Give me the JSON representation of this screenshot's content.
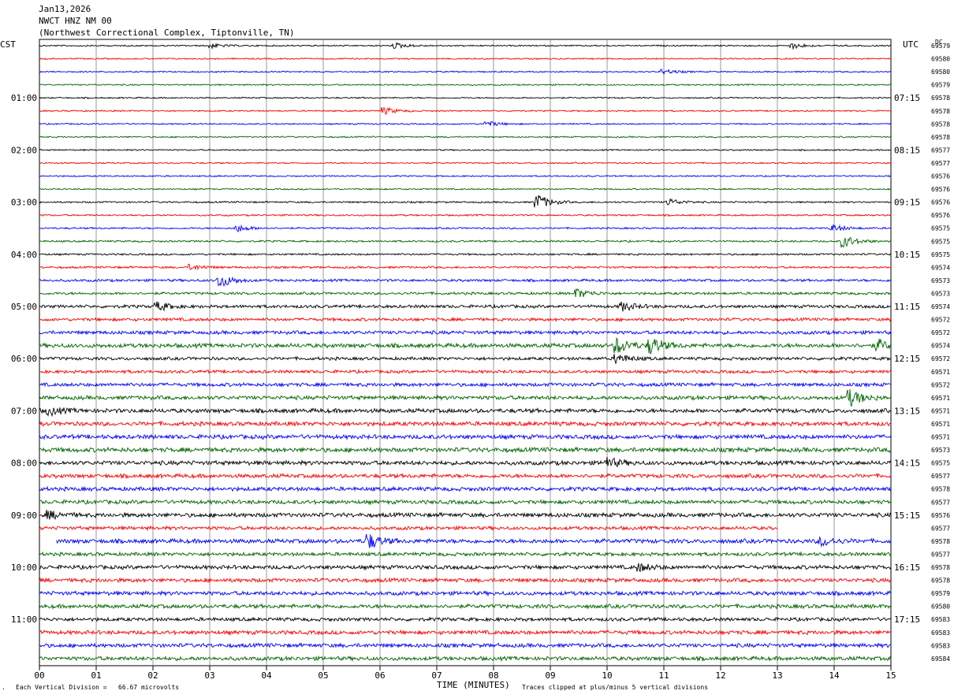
{
  "header": {
    "date": "Jan13,2026",
    "station": "NWCT HNZ NM 00",
    "site": "(Northwest Correctional Complex, Tiptonville, TN)"
  },
  "left_zone_label": "CST",
  "right_zone_label": "UTC",
  "dc_label": "DC",
  "footer": {
    "scale": "Each Vertical Division =   66.67 microvolts",
    "xlabel": "TIME (MINUTES)",
    "clip_note": "Traces clipped at plus/minus 5 vertical divisions"
  },
  "chart_data": {
    "type": "line",
    "title": "NWCT HNZ NM 00",
    "xlabel": "TIME (MINUTES)",
    "ylabel": "",
    "xlim": [
      0,
      15
    ],
    "x_ticks": [
      "00",
      "01",
      "02",
      "03",
      "04",
      "05",
      "06",
      "07",
      "08",
      "09",
      "10",
      "11",
      "12",
      "13",
      "14",
      "15"
    ],
    "grid": true,
    "trace_count": 48,
    "trace_colors": [
      "#000000",
      "#ff0000",
      "#0000ff",
      "#006400"
    ],
    "left_time_labels": [
      "01:00",
      "02:00",
      "03:00",
      "04:00",
      "05:00",
      "06:00",
      "07:00",
      "08:00",
      "09:00",
      "10:00",
      "11:00"
    ],
    "right_time_labels": [
      "07:15",
      "08:15",
      "09:15",
      "10:15",
      "11:15",
      "12:15",
      "13:15",
      "14:15",
      "15:15",
      "16:15",
      "17:15"
    ],
    "dc_offsets": [
      "69579",
      "69580",
      "69580",
      "69579",
      "69578",
      "69578",
      "69578",
      "69578",
      "69577",
      "69577",
      "69576",
      "69576",
      "69576",
      "69576",
      "69575",
      "69575",
      "69575",
      "69574",
      "69573",
      "69573",
      "69574",
      "69572",
      "69572",
      "69574",
      "69572",
      "69571",
      "69572",
      "69571",
      "69571",
      "69571",
      "69571",
      "69573",
      "69575",
      "69577",
      "69578",
      "69577",
      "69576",
      "69577",
      "69578",
      "69577",
      "69578",
      "69578",
      "69579",
      "69580",
      "69583",
      "69583",
      "69583",
      "69584"
    ],
    "activity": [
      1,
      1,
      1,
      1,
      1,
      1,
      1,
      1,
      1,
      1,
      1,
      1,
      1.2,
      1.2,
      1.2,
      1.3,
      1.3,
      1.5,
      1.8,
      1.8,
      2.2,
      2.2,
      2.5,
      3,
      2.2,
      2.2,
      2.5,
      2.8,
      3,
      3,
      3,
      3.2,
      3,
      2.8,
      2.8,
      2.8,
      3,
      2.5,
      3,
      2.5,
      2.8,
      2.8,
      2.8,
      2.8,
      2.5,
      2.8,
      2.8,
      2.8
    ],
    "events": [
      {
        "trace": 0,
        "minute": 3.0,
        "amp": 3
      },
      {
        "trace": 0,
        "minute": 6.3,
        "amp": 3
      },
      {
        "trace": 0,
        "minute": 13.3,
        "amp": 3
      },
      {
        "trace": 2,
        "minute": 11.0,
        "amp": 3
      },
      {
        "trace": 5,
        "minute": 6.1,
        "amp": 4
      },
      {
        "trace": 6,
        "minute": 7.9,
        "amp": 3
      },
      {
        "trace": 12,
        "minute": 8.8,
        "amp": 9
      },
      {
        "trace": 12,
        "minute": 11.1,
        "amp": 4
      },
      {
        "trace": 14,
        "minute": 3.5,
        "amp": 4
      },
      {
        "trace": 14,
        "minute": 14.0,
        "amp": 4
      },
      {
        "trace": 15,
        "minute": 14.2,
        "amp": 7
      },
      {
        "trace": 17,
        "minute": 2.7,
        "amp": 3
      },
      {
        "trace": 18,
        "minute": 3.2,
        "amp": 8
      },
      {
        "trace": 19,
        "minute": 9.5,
        "amp": 5
      },
      {
        "trace": 20,
        "minute": 2.1,
        "amp": 5
      },
      {
        "trace": 20,
        "minute": 10.3,
        "amp": 5
      },
      {
        "trace": 23,
        "minute": 10.2,
        "amp": 9
      },
      {
        "trace": 23,
        "minute": 10.8,
        "amp": 9
      },
      {
        "trace": 23,
        "minute": 14.8,
        "amp": 6
      },
      {
        "trace": 24,
        "minute": 10.2,
        "amp": 5
      },
      {
        "trace": 27,
        "minute": 14.3,
        "amp": 9
      },
      {
        "trace": 28,
        "minute": 0.2,
        "amp": 4
      },
      {
        "trace": 32,
        "minute": 10.0,
        "amp": 6
      },
      {
        "trace": 36,
        "minute": 0.2,
        "amp": 4
      },
      {
        "trace": 38,
        "minute": 5.8,
        "amp": 9
      },
      {
        "trace": 38,
        "minute": 13.8,
        "amp": 5
      },
      {
        "trace": 40,
        "minute": 10.6,
        "amp": 4
      }
    ],
    "note": "Trace 37 ends at about minute 13.0; trace 38 begins at about minute 0.3"
  }
}
